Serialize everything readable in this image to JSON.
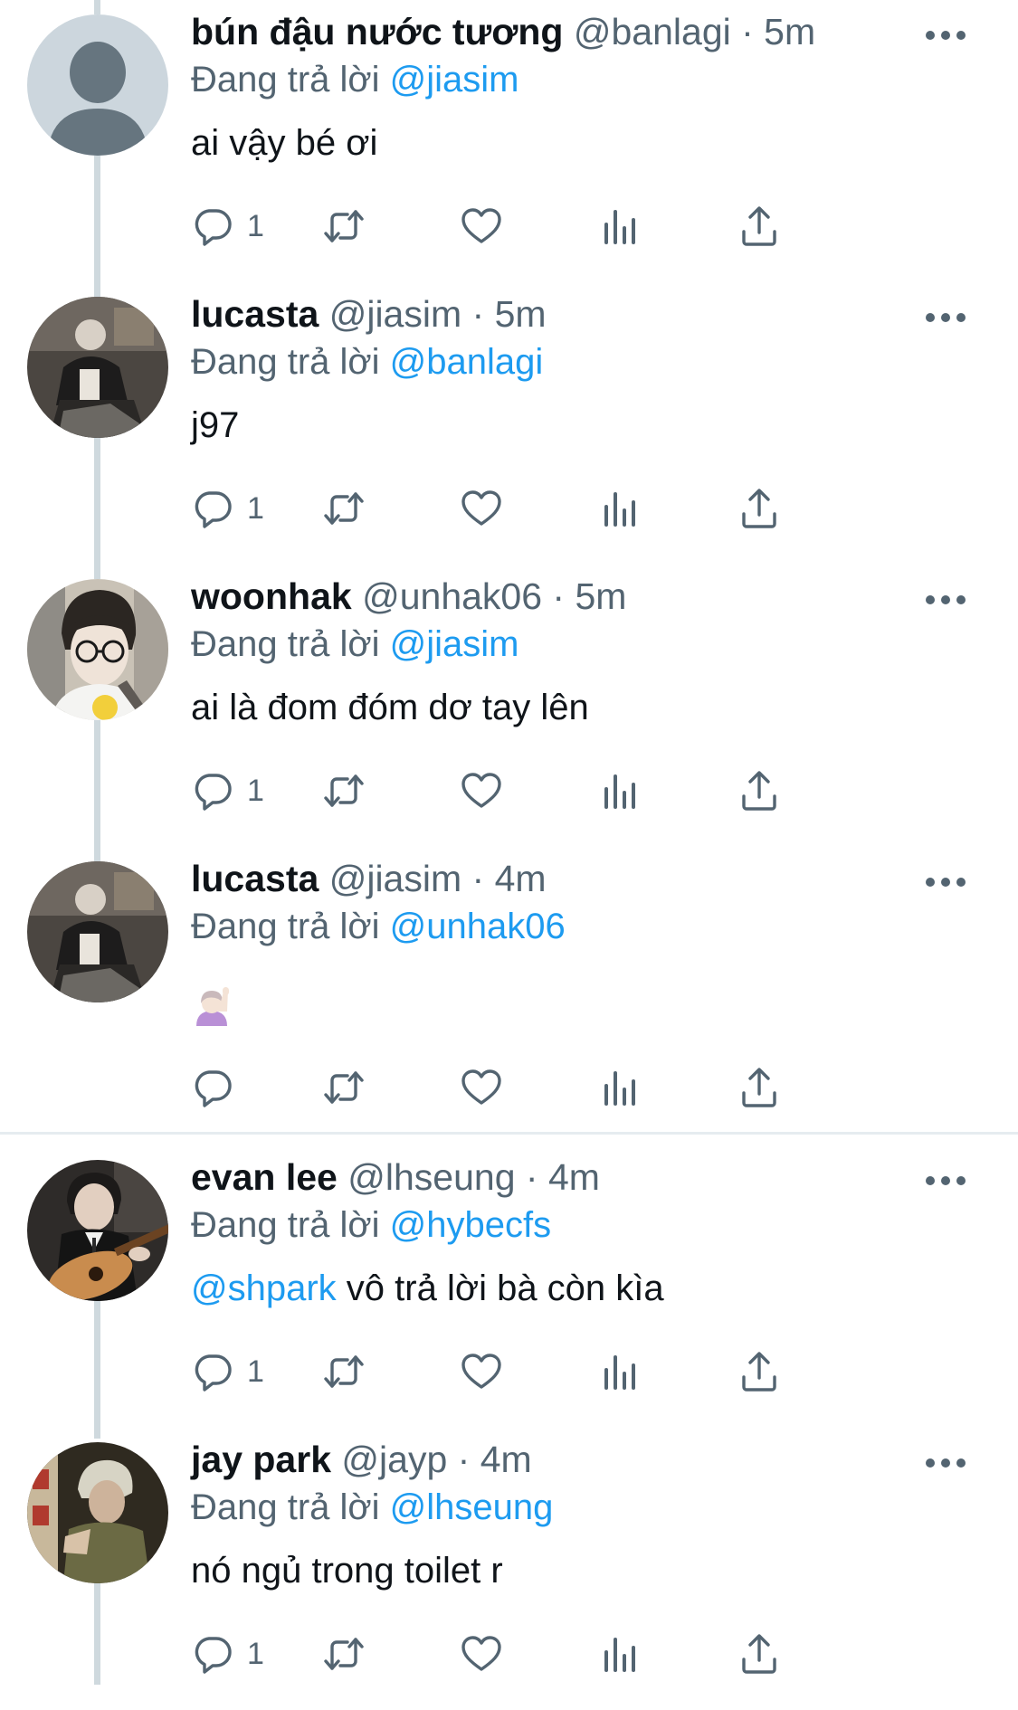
{
  "colors": {
    "link": "#1d9bf0",
    "secondary": "#536471",
    "primary": "#0f1419",
    "thread_line": "#cfd9de"
  },
  "icons": {
    "reply": "reply-icon",
    "retweet": "retweet-icon",
    "like": "heart-icon",
    "views": "analytics-icon",
    "share": "share-icon",
    "more": "more-icon"
  },
  "tweets": [
    {
      "display_name": "bún đậu nước tương",
      "handle": "@banlagi",
      "time": "5m",
      "replying_label": "Đang trả lời",
      "replying_to": "@jiasim",
      "mention": "",
      "text": "ai vậy bé ơi",
      "emoji": "",
      "reply_count": "1"
    },
    {
      "display_name": "lucasta",
      "handle": "@jiasim",
      "time": "5m",
      "replying_label": "Đang trả lời",
      "replying_to": "@banlagi",
      "mention": "",
      "text": "j97",
      "emoji": "",
      "reply_count": "1"
    },
    {
      "display_name": "woonhak",
      "handle": "@unhak06",
      "time": "5m",
      "replying_label": "Đang trả lời",
      "replying_to": "@jiasim",
      "mention": "",
      "text": "ai là đom đóm dơ tay lên",
      "emoji": "",
      "reply_count": "1"
    },
    {
      "display_name": "lucasta",
      "handle": "@jiasim",
      "time": "4m",
      "replying_label": "Đang trả lời",
      "replying_to": "@unhak06",
      "mention": "",
      "text": "",
      "emoji": "raising-hand-emoji",
      "reply_count": ""
    },
    {
      "display_name": "evan lee",
      "handle": "@lhseung",
      "time": "4m",
      "replying_label": "Đang trả lời",
      "replying_to": "@hybecfs",
      "mention": "@shpark",
      "text": "vô trả lời bà còn kìa",
      "emoji": "",
      "reply_count": "1"
    },
    {
      "display_name": "jay park",
      "handle": "@jayp",
      "time": "4m",
      "replying_label": "Đang trả lời",
      "replying_to": "@lhseung",
      "mention": "",
      "text": "nó ngủ trong toilet r",
      "emoji": "",
      "reply_count": "1"
    }
  ]
}
